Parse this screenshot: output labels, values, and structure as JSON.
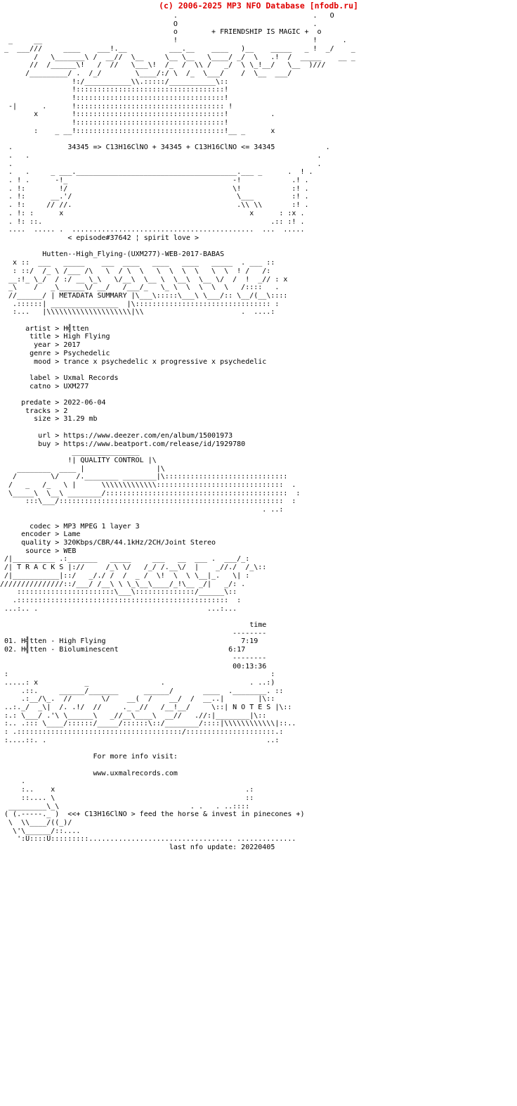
{
  "site_header": "(c) 2006-2025 MP3 NFO Database [nfodb.ru]",
  "logo": {
    "tagline": "+ FRIENDSHIP IS MAGIC +",
    "formula_line": "34345 => C13H16ClNO + 34345 + C13H16ClNO <= 34345",
    "ascii": "                                         .                                .   O\n                                         O                                .\n                                         o        + FRIENDSHIP IS MAGIC +  o\n  _     __                               !                                !      .\n _  ___///     ____    ___!.__          ___.__    ____   )__    _____   _ !  _/    _\n        /   \\_______\\ /  __//  \\__     \\__ \\__   \\____/ _/  \\   .!  /  _____    __ _\n       //  /______\\!   /  //   \\___\\!  /_  /  \\\\ /   _/  \\ \\_!__/   \\__  )///\n      /_________/ .  /_/        \\____/:/ \\  /_  \\___/    /  \\__  ___/\n                 !:/___________\\\\.:::::/___________\\::\n                 !:::::::::::::::::::::::::::::::::::!\n                 !:::::::::::::::::::::::::::::::::::!\n  -|      .      !::::::::::::::::::::::::::::::::::: !\n        x        !:::::::::::::::::::::::::::::::::::!          .\n                 !:::::::::::::::::::::::::::::::::::!\n        :    _ __!:::::::::::::::::::::::::::::::::::!__ _      x\n\n  .             34345 => C13H16ClNO + 34345 + C13H16ClNO <= 34345            .\n  .   .                                                                    .\n  .                                                                        .\n  .   .     _ ___.______________________________________.___ _      .  ! .\n  . ! .      -!_                                       -!            .! .\n  . !:        !/                                       \\!            :! .\n  . !:      __.'/                                       \\___         :! .\n  . !:     // //.                                       .\\\\ \\\\       :! .\n  . !: :      x                                            x      : :x .\n  . !: ::.                                                      .:: :! .\n  ....  ..... .  ...........................................  ...  .....",
    "episode": "< episode#37642 ¦ spirit love >",
    "release": "Hutten--High_Flying-(UXM277)-WEB-2017-BABAS"
  },
  "metadata_banner": {
    "label": "METADATA SUMMARY",
    "ascii": "   x ::  ___   _____    ___  ____   ____   ____   _____  . ___ ::\n   : ::/  /_ \\ /___ /\\   \\  / \\  \\   \\  \\  \\  \\   \\  \\  ! /   /:\n  __:!_ \\_/  / :/ __ \\_\\   \\/__\\  \\__ \\  \\__\\  \\__ \\/  /  !  _// : x\n  _\\    /   _\\______\\/ __/   /___/_   \\_ \\  \\  \\  \\  \\   /::::   .\n  //______/ | METADATA SUMMARY |\\___\\:::::\\___\\ \\___/:: \\__/(__\\::::\n   .::::::| ________________  |\\:::::::::::::::::::::::::::::::: :\n   :...   |\\\\\\\\\\\\\\\\\\\\\\\\\\\\\\\\\\\\\\\\|\\\\                       .  ....:"
  },
  "metadata": {
    "fields": [
      {
        "key": "artist",
        "value": "H╣tten"
      },
      {
        "key": "title",
        "value": "High Flying"
      },
      {
        "key": "year",
        "value": "2017"
      },
      {
        "key": "genre",
        "value": "Psychedelic"
      },
      {
        "key": "mood",
        "value": "trance x psychedelic x progressive x psychedelic"
      }
    ],
    "label_fields": [
      {
        "key": "label",
        "value": "Uxmal Records"
      },
      {
        "key": "catno",
        "value": "UXM277"
      }
    ],
    "release_fields": [
      {
        "key": "predate",
        "value": "2022-06-04"
      },
      {
        "key": "tracks",
        "value": "2"
      },
      {
        "key": "size",
        "value": "31.29 mb"
      }
    ],
    "link_fields": [
      {
        "key": "url",
        "value": "https://www.deezer.com/en/album/15001973"
      },
      {
        "key": "buy",
        "value": "https://www.beatport.com/release/id/1929780"
      }
    ]
  },
  "quality_banner": {
    "label": "QUALITY CONTROL",
    "ascii": "                 ________________\n                !| QUALITY CONTROL |\\\n    ________  ____ |                 |\\\n   /        \\/    /.________ ________|\\:::::::::::::::::::::::::::::\n  /   _   /_   \\ |      \\\\\\\\\\\\\\\\\\\\\\\\\\::::::::::::::::::::::::::::::  .\n  \\_____\\  \\__\\ ________/:::::::::::::::::::::::::::::::::::::::::::  :\n      :::\\___/:::::::::::::::::::::::::::::::::::::::::::::::::::::  :\n                                                              . ..:"
  },
  "quality": {
    "fields": [
      {
        "key": "codec",
        "value": "MP3 MPEG 1 layer 3"
      },
      {
        "key": "encoder",
        "value": "Lame"
      },
      {
        "key": "quality",
        "value": "320Kbps/CBR/44.1kHz/2CH/Joint Stereo"
      },
      {
        "key": "source",
        "value": "WEB"
      }
    ]
  },
  "tracks_banner": {
    "label": "T R A C K S",
    "ascii": " /|__________ .:_______   _____     ___   __  ___ .  ___/_:\n /| T R A C K S |://     /_\\ \\/   /_/ /.__\\/  |    _//./  /_\\::\n /|___________|::/   _/./ /  /  _ /  \\!  \\  \\ \\__|_.   \\| :\n///////////////::/___/ /__\\ \\ \\_\\__\\____/_!\\__ _/|   _/: .\n    :::::::::::::::::::::::\\___\\::::::::::::::/______\\::\n   .::::::::::::::::::::::::::::::::::::::::::::::::::  :\n ...:.. .                                        ...:..."
  },
  "tracks": {
    "time_header": "time",
    "divider": "--------",
    "items": [
      {
        "num": "01.",
        "title": "H╣tten - High Flying",
        "time": "7:19"
      },
      {
        "num": "02.",
        "title": "H╣tten - Bioluminescent",
        "time": "6:17"
      }
    ],
    "total": "00:13:36"
  },
  "notes_banner": {
    "label": "N O T E S",
    "ascii": " :                                                              :\n .....: x           _                 .                    . ..:)\n     .::.     ______/_______      ______/       ____  .________. ::\n     .:__/\\_.  //       \\/    __(  /    __/  /  __..|        |\\::\n ..:._/  _\\|  /. .!/  //     ._ _//   /__!__/     \\::| N O T E S |\\::\n :.: \\___/ .'\\ \\______\\   _//__\\____\\  __//   .//:|________|\\::\n :.. .::: \\____/::::::/_____/::::::\\::/________/::::|\\\\\\\\\\\\\\\\\\\\\\\\|::..\n : .:::::::::::::::::::::::::::::::::::::::/:::::::::::::::::::::.:\n :....::. .                                                    ..:"
  },
  "notes": {
    "line1": "For more info visit:",
    "line2": "www.uxmalrecords.com"
  },
  "footer": {
    "ascii": "     .\n     :..    x                                             .:\n     ::.... \\                                             ::\n  _________\\_\\                               . .   . ..::::\n ( (.-----._ )  <<+ C13H16ClNO > feed the horse & invest in pinecones +)\n  \\  \\\\____/((_)/\n   \\'\\______/::....\n    ':U::::U:::::::::.................................. ..............",
    "tagline": "<<+ C13H16ClNO > feed the horse & invest in pinecones +)",
    "last_update": "last nfo update: 20220405"
  }
}
